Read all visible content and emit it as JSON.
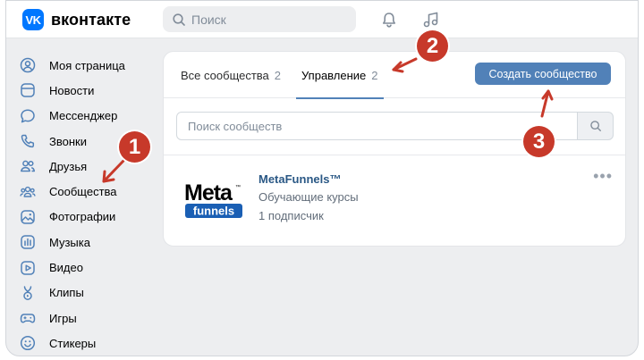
{
  "app": {
    "logo_mark": "VK",
    "logo_text": "вконтакте"
  },
  "header": {
    "search_placeholder": "Поиск",
    "bell_icon": "bell-icon",
    "music_icon": "music-note-icon"
  },
  "sidebar": {
    "items": [
      {
        "label": "Моя страница",
        "icon": "user-circle-icon"
      },
      {
        "label": "Новости",
        "icon": "news-icon"
      },
      {
        "label": "Мессенджер",
        "icon": "chat-bubble-icon"
      },
      {
        "label": "Звонки",
        "icon": "phone-icon"
      },
      {
        "label": "Друзья",
        "icon": "friends-icon"
      },
      {
        "label": "Сообщества",
        "icon": "communities-icon"
      },
      {
        "label": "Фотографии",
        "icon": "photo-icon"
      },
      {
        "label": "Музыка",
        "icon": "music-bars-icon"
      },
      {
        "label": "Видео",
        "icon": "video-icon"
      },
      {
        "label": "Клипы",
        "icon": "clips-icon"
      },
      {
        "label": "Игры",
        "icon": "gamepad-icon"
      },
      {
        "label": "Стикеры",
        "icon": "smile-icon"
      }
    ]
  },
  "main": {
    "tabs": [
      {
        "label": "Все сообщества",
        "count": "2"
      },
      {
        "label": "Управление",
        "count": "2"
      }
    ],
    "create_button": "Создать сообщество",
    "search_placeholder": "Поиск сообществ",
    "community": {
      "name": "MetaFunnels™",
      "category": "Обучающие курсы",
      "subscribers": "1 подписчик",
      "logo_word1": "Meta",
      "logo_tm": "™",
      "logo_word2": "funnels",
      "more": "•••"
    }
  },
  "annotations": {
    "badge1": "1",
    "badge2": "2",
    "badge3": "3",
    "color": "#c7392a"
  }
}
